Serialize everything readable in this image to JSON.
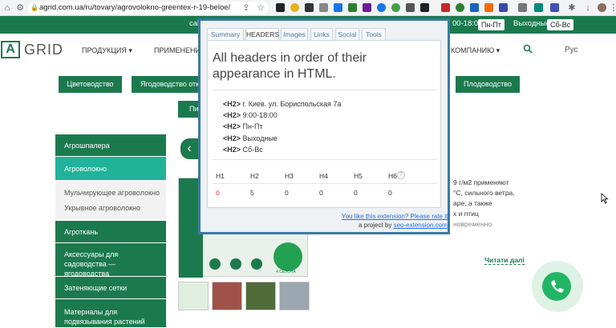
{
  "browser": {
    "url": "agrid.com.ua/ru/tovary/agrovolokno-greentex-r-19-beloe/"
  },
  "topbar": {
    "left_text": "cal",
    "hours_text": "00-18:00",
    "weekdays": "Пн-Пт",
    "weekend_label": "Выходные",
    "weekend_days": "Сб-Вс"
  },
  "site": {
    "logo_letter": "A",
    "logo_text": "GRID",
    "nav": [
      "ПРОДУКЦИЯ",
      "ПРИМЕНЕНИЕ",
      "КОМПАНИЮ"
    ],
    "lang": "Рус",
    "cat_buttons": [
      "Цветоводство",
      "Ягодоводство откр",
      "Плодоводство",
      "Пи"
    ]
  },
  "sidebar": {
    "items": [
      {
        "label": "Агрошпалера"
      },
      {
        "label": "Агроволокно"
      },
      {
        "label": "Агроткань"
      },
      {
        "label": "Аксессуары для садоводства — ягодоводства"
      },
      {
        "label": "Затеняющие сетки"
      },
      {
        "label": "Материалы для подвязывания растений"
      }
    ],
    "subitems": [
      "Мульчирующее агроволокно",
      "Укрывное агроволокно"
    ]
  },
  "content": {
    "desc_lines": [
      "9 г/м2 применяют",
      "°С, сильного ветра,",
      "аре, а также",
      "х и птиц",
      "новременно"
    ],
    "read_more": "Читати далі",
    "badge_text": "4 СЕЗОНА"
  },
  "popup": {
    "tabs": [
      "Summary",
      "HEADERS",
      "Images",
      "Links",
      "Social",
      "Tools"
    ],
    "active_tab": "HEADERS",
    "title": "All headers in order of their appearance in HTML.",
    "headers": [
      {
        "tag": "<H2>",
        "text": "г. Киев. ул. Бориспольская 7а"
      },
      {
        "tag": "<H2>",
        "text": "9:00-18:00"
      },
      {
        "tag": "<H2>",
        "text": "Пн-Пт"
      },
      {
        "tag": "<H2>",
        "text": "Выходные"
      },
      {
        "tag": "<H2>",
        "text": "Сб-Вс"
      }
    ],
    "counts": [
      {
        "label": "H1",
        "value": "0"
      },
      {
        "label": "H2",
        "value": "5"
      },
      {
        "label": "H3",
        "value": "0"
      },
      {
        "label": "H4",
        "value": "0"
      },
      {
        "label": "H5",
        "value": "0"
      },
      {
        "label": "H6",
        "value": "0"
      }
    ],
    "rate_link": "You like this extension? Please rate it!",
    "by_prefix": "a project by",
    "by_link": "seo-extension.com"
  },
  "colors": {
    "brand_green": "#1b7a4d",
    "active_teal": "#20b39a",
    "popup_border": "#3a7aa6",
    "h1_zero": "#e53935"
  }
}
